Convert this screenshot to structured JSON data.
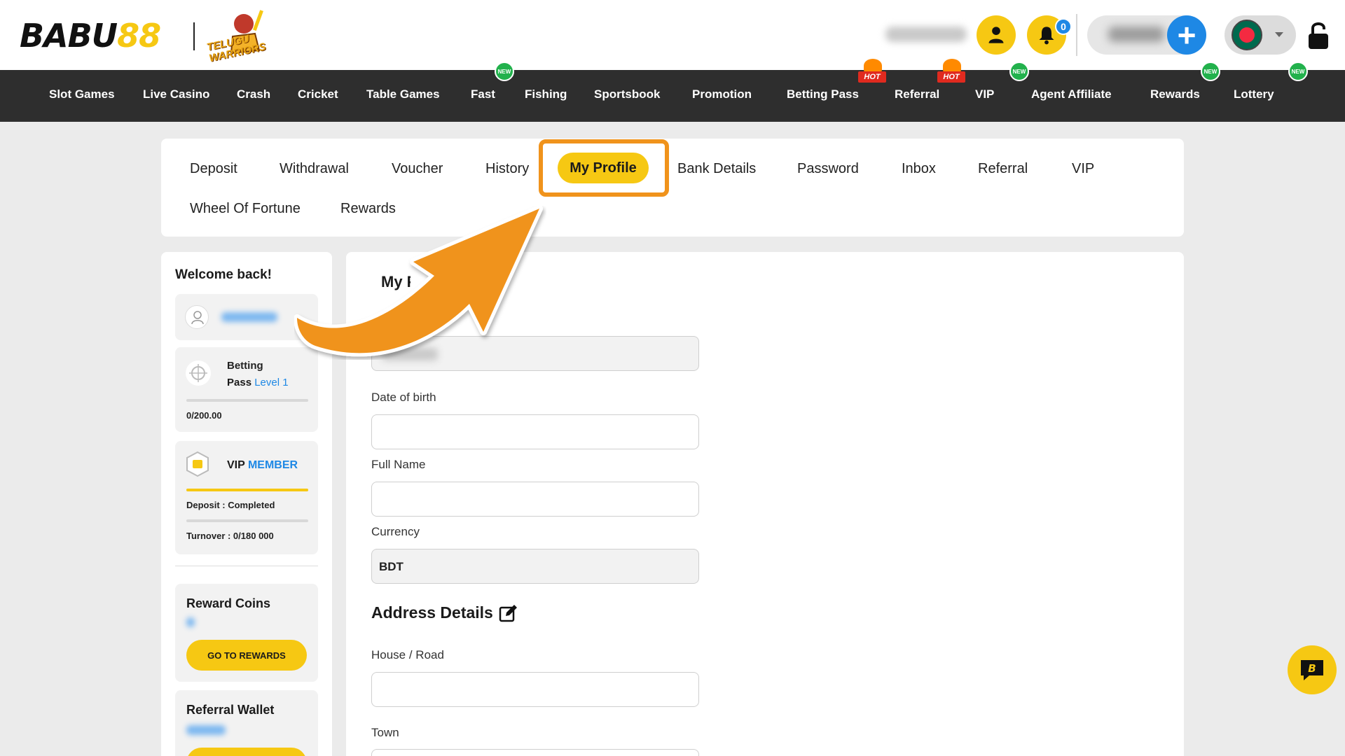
{
  "brand": {
    "logo_left": "BABU",
    "logo_right": "88",
    "partner_text": "TELUGU WARRIORS"
  },
  "header": {
    "notification_count": "0"
  },
  "nav": {
    "items": [
      {
        "label": "Slot Games"
      },
      {
        "label": "Live Casino"
      },
      {
        "label": "Crash"
      },
      {
        "label": "Cricket"
      },
      {
        "label": "Table Games"
      },
      {
        "label": "Fast",
        "tag": "NEW"
      },
      {
        "label": "Fishing"
      },
      {
        "label": "Sportsbook"
      },
      {
        "label": "Promotion"
      },
      {
        "label": "Betting Pass",
        "tag": "HOT"
      },
      {
        "label": "Referral",
        "tag": "HOT"
      },
      {
        "label": "VIP",
        "tag": "NEW"
      },
      {
        "label": "Agent Affiliate"
      },
      {
        "label": "Rewards",
        "tag": "NEW"
      },
      {
        "label": "Lottery",
        "tag": "NEW"
      }
    ]
  },
  "tabs": {
    "row1": [
      "Deposit",
      "Withdrawal",
      "Voucher",
      "History",
      "My Profile",
      "Bank Details",
      "Password",
      "Inbox",
      "Referral",
      "VIP"
    ],
    "row2": [
      "Wheel Of Fortune",
      "Rewards"
    ],
    "active": "My Profile"
  },
  "sidebar": {
    "welcome": "Welcome back!",
    "betting_pass": {
      "line1": "Betting",
      "line2": "Pass",
      "level": "Level 1",
      "progress_text": "0/200.00",
      "progress": 0
    },
    "vip": {
      "label": "VIP",
      "tier": "MEMBER",
      "deposit_text": "Deposit : Completed",
      "deposit_progress": 1.0,
      "turnover_text": "Turnover : 0/180 000",
      "turnover_progress": 0
    },
    "reward_coins": {
      "title": "Reward Coins",
      "button": "GO TO REWARDS"
    },
    "referral_wallet": {
      "title": "Referral Wallet"
    }
  },
  "main": {
    "title": "My Profile",
    "fields": [
      {
        "label": "Date of birth",
        "value": ""
      },
      {
        "label": "Full Name",
        "value": ""
      },
      {
        "label": "Currency",
        "value": "BDT"
      }
    ],
    "address_section": "Address Details",
    "address_fields": [
      {
        "label": "House / Road",
        "value": ""
      },
      {
        "label": "Town",
        "value": ""
      }
    ]
  },
  "colors": {
    "accent": "#f6c813",
    "nav_bg": "#2e2e2e",
    "link_blue": "#1e88e5",
    "highlight_orange": "#f0931c",
    "new_green": "#22b14c",
    "hot_red": "#e02a1f"
  }
}
